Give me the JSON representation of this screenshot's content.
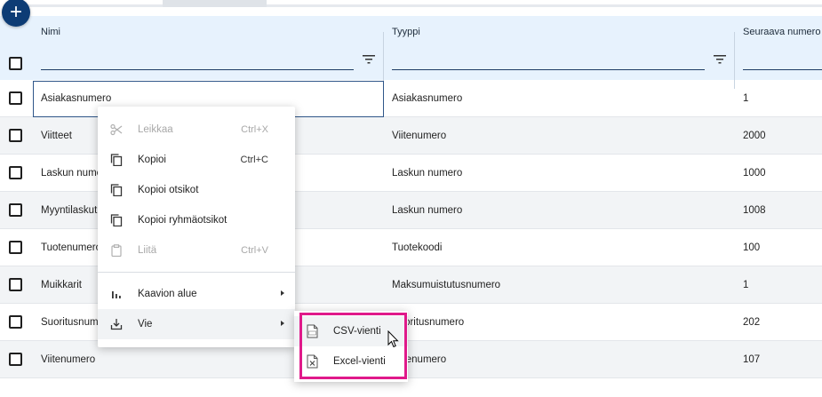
{
  "fab": {
    "label": "+"
  },
  "columns": [
    {
      "key": "name",
      "label": "Nimi"
    },
    {
      "key": "type",
      "label": "Tyyppi"
    },
    {
      "key": "next",
      "label": "Seuraava numero"
    }
  ],
  "rows": [
    {
      "name": "Asiakasnumero",
      "type": "Asiakasnumero",
      "next": "1"
    },
    {
      "name": "Viitteet",
      "type": "Viitenumero",
      "next": "2000"
    },
    {
      "name": "Laskun numero",
      "type": "Laskun numero",
      "next": "1000"
    },
    {
      "name": "Myyntilaskut",
      "type": "Laskun numero",
      "next": "1008"
    },
    {
      "name": "Tuotenumero",
      "type": "Tuotekoodi",
      "next": "100"
    },
    {
      "name": "Muikkarit",
      "type": "Maksumuistutusnumero",
      "next": "1"
    },
    {
      "name": "Suoritusnumero",
      "type": "Suoritusnumero",
      "next": "202"
    },
    {
      "name": "Viitenumero",
      "type": "Viitenumero",
      "next": "107"
    }
  ],
  "context_menu": {
    "items": [
      {
        "label": "Leikkaa",
        "shortcut": "Ctrl+X",
        "icon": "scissors-icon",
        "disabled": true
      },
      {
        "label": "Kopioi",
        "shortcut": "Ctrl+C",
        "icon": "copy-icon",
        "disabled": false
      },
      {
        "label": "Kopioi otsikot",
        "shortcut": "",
        "icon": "copy-icon",
        "disabled": false
      },
      {
        "label": "Kopioi ryhmäotsikot",
        "shortcut": "",
        "icon": "copy-icon",
        "disabled": false
      },
      {
        "label": "Liitä",
        "shortcut": "Ctrl+V",
        "icon": "clipboard-icon",
        "disabled": true
      },
      {
        "label": "Kaavion alue",
        "shortcut": "",
        "icon": "chart-icon",
        "disabled": false
      },
      {
        "label": "Vie",
        "shortcut": "",
        "icon": "export-icon",
        "disabled": false
      }
    ]
  },
  "export_submenu": {
    "items": [
      {
        "label": "CSV-vienti",
        "icon": "csv-file-icon"
      },
      {
        "label": "Excel-vienti",
        "icon": "excel-file-icon"
      }
    ]
  },
  "colors": {
    "fab": "#0d3c75",
    "header_bg": "#e7f2fd",
    "highlight": "#e0198a"
  }
}
